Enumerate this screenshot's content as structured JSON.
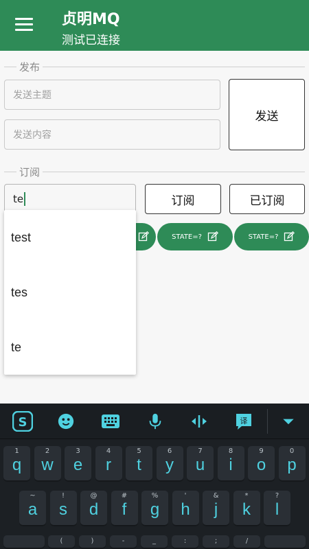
{
  "appbar": {
    "title": "贞明MQ",
    "subtitle": "测试已连接"
  },
  "publish": {
    "section_label": "发布",
    "topic_placeholder": "发送主题",
    "content_placeholder": "发送内容",
    "send_label": "发送"
  },
  "subscribe": {
    "section_label": "订阅",
    "input_value": "te",
    "subscribe_label": "订阅",
    "subscribed_label": "已订阅"
  },
  "chips": [
    {
      "label": "STATE=?"
    },
    {
      "label": "STATE=?"
    }
  ],
  "autocomplete": [
    "test",
    "tes",
    "te"
  ],
  "keyboard": {
    "row1": [
      {
        "sub": "1",
        "main": "q"
      },
      {
        "sub": "2",
        "main": "w"
      },
      {
        "sub": "3",
        "main": "e"
      },
      {
        "sub": "4",
        "main": "r"
      },
      {
        "sub": "5",
        "main": "t"
      },
      {
        "sub": "6",
        "main": "y"
      },
      {
        "sub": "7",
        "main": "u"
      },
      {
        "sub": "8",
        "main": "i"
      },
      {
        "sub": "9",
        "main": "o"
      },
      {
        "sub": "0",
        "main": "p"
      }
    ],
    "row2": [
      {
        "sub": "~",
        "main": "a"
      },
      {
        "sub": "!",
        "main": "s"
      },
      {
        "sub": "@",
        "main": "d"
      },
      {
        "sub": "#",
        "main": "f"
      },
      {
        "sub": "%",
        "main": "g"
      },
      {
        "sub": "'",
        "main": "h"
      },
      {
        "sub": "&",
        "main": "j"
      },
      {
        "sub": "*",
        "main": "k"
      },
      {
        "sub": "?",
        "main": "l"
      }
    ],
    "row3_subs": [
      "(",
      ")",
      "-",
      "_",
      ":",
      ";",
      "/"
    ]
  },
  "colors": {
    "primary": "#2e8b57",
    "key_text": "#4fd1e0"
  }
}
